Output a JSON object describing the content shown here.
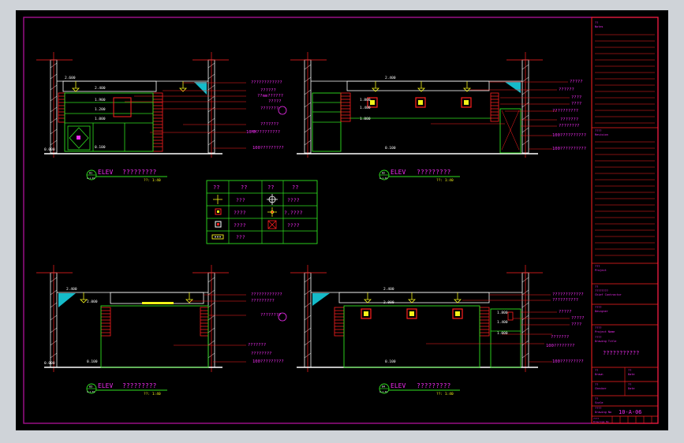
{
  "elevations": [
    {
      "label": "ELEV",
      "title": "?????????",
      "scale": "??: 1:40",
      "num": "01",
      "sub": "A-1-01"
    },
    {
      "label": "ELEV",
      "title": "?????????",
      "scale": "??: 1:40",
      "num": "02",
      "sub": "A-1-01"
    },
    {
      "label": "ELEV",
      "title": "?????????",
      "scale": "??: 1:40",
      "num": "03",
      "sub": "A-1-01"
    },
    {
      "label": "ELEV",
      "title": "?????????",
      "scale": "??: 1:40",
      "num": "04",
      "sub": "A-1-01"
    }
  ],
  "elev1_dims": [
    "2.600",
    "2.400",
    "1.900",
    "1.200",
    "1.000",
    "0.100",
    "0.000"
  ],
  "elev1_notes": [
    "????????????",
    "??????",
    "??mm??????",
    "?????",
    "???????",
    "???????",
    "10MM?????????",
    "100?????????"
  ],
  "elev2_dims": [
    "2.400",
    "1.800",
    "1.400",
    "1.000",
    "0.100"
  ],
  "elev2_notes": [
    "?????",
    "??????",
    "????",
    "????",
    "??????????",
    "???????",
    "????????",
    "100??????????",
    "100??????????"
  ],
  "elev3_dims": [
    "2.400",
    "2.000",
    "0.100",
    "0.000"
  ],
  "elev3_notes": [
    "????????????",
    "?????????",
    "????????",
    "???????",
    "????????",
    "100?????????"
  ],
  "elev4_dims": [
    "2.400",
    "2.000",
    "1.800",
    "1.400",
    "1.000",
    "0.100"
  ],
  "elev4_notes": [
    "????????????",
    "??????????",
    "?????",
    "?????",
    "????",
    "???????",
    "100????????",
    "100?????????"
  ],
  "legend": {
    "headers": [
      "??",
      "??",
      "??",
      "??"
    ],
    "rows": [
      [
        "???",
        "????"
      ],
      [
        "????",
        "?.????"
      ],
      [
        "????",
        "????"
      ],
      [
        "???",
        ""
      ]
    ]
  },
  "title_block": {
    "top": [
      "??",
      "Notes"
    ],
    "mid": [
      "????",
      "Revision"
    ],
    "s1": [
      "???",
      "Project"
    ],
    "s2": [
      "??",
      "????????",
      "Chief Contractor"
    ],
    "s3": [
      "????",
      "Designer"
    ],
    "s4": [
      "????",
      "Project Name",
      "????",
      "Drawing Title"
    ],
    "drawing_title": "???????????",
    "s5": [
      "??",
      "??",
      "Drawn",
      "Date"
    ],
    "s6": [
      "??",
      "??",
      "Checker",
      "Date"
    ],
    "s7": [
      "??",
      "Scale"
    ],
    "drawing_no_label": "????",
    "drawing_no_en": "Drawing No",
    "drawing_no": "10-A-06",
    "s8": [
      "????",
      "Drawings No"
    ]
  },
  "colors": {
    "paper": "#000000",
    "border": "#a4108e",
    "red": "#ff1f1f",
    "green": "#2fe11f",
    "yellow": "#f2f21a",
    "magenta": "#f02cf0",
    "cyan": "#19dcec",
    "white": "#ffffff"
  }
}
